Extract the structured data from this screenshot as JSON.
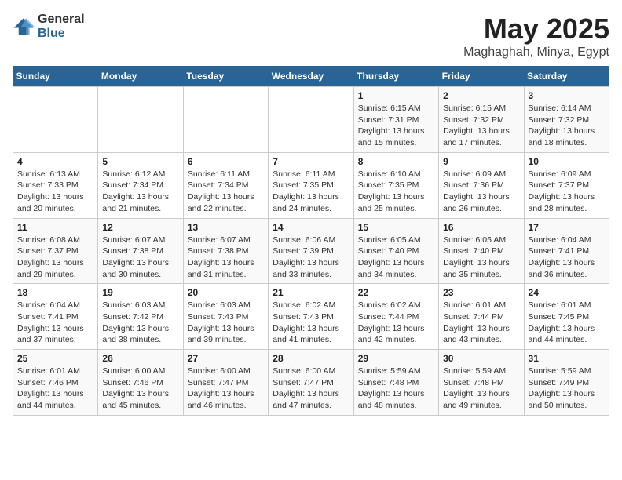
{
  "logo": {
    "general": "General",
    "blue": "Blue"
  },
  "calendar": {
    "title": "May 2025",
    "subtitle": "Maghaghah, Minya, Egypt"
  },
  "weekdays": [
    "Sunday",
    "Monday",
    "Tuesday",
    "Wednesday",
    "Thursday",
    "Friday",
    "Saturday"
  ],
  "weeks": [
    [
      {
        "day": "",
        "info": ""
      },
      {
        "day": "",
        "info": ""
      },
      {
        "day": "",
        "info": ""
      },
      {
        "day": "",
        "info": ""
      },
      {
        "day": "1",
        "info": "Sunrise: 6:15 AM\nSunset: 7:31 PM\nDaylight: 13 hours and 15 minutes."
      },
      {
        "day": "2",
        "info": "Sunrise: 6:15 AM\nSunset: 7:32 PM\nDaylight: 13 hours and 17 minutes."
      },
      {
        "day": "3",
        "info": "Sunrise: 6:14 AM\nSunset: 7:32 PM\nDaylight: 13 hours and 18 minutes."
      }
    ],
    [
      {
        "day": "4",
        "info": "Sunrise: 6:13 AM\nSunset: 7:33 PM\nDaylight: 13 hours and 20 minutes."
      },
      {
        "day": "5",
        "info": "Sunrise: 6:12 AM\nSunset: 7:34 PM\nDaylight: 13 hours and 21 minutes."
      },
      {
        "day": "6",
        "info": "Sunrise: 6:11 AM\nSunset: 7:34 PM\nDaylight: 13 hours and 22 minutes."
      },
      {
        "day": "7",
        "info": "Sunrise: 6:11 AM\nSunset: 7:35 PM\nDaylight: 13 hours and 24 minutes."
      },
      {
        "day": "8",
        "info": "Sunrise: 6:10 AM\nSunset: 7:35 PM\nDaylight: 13 hours and 25 minutes."
      },
      {
        "day": "9",
        "info": "Sunrise: 6:09 AM\nSunset: 7:36 PM\nDaylight: 13 hours and 26 minutes."
      },
      {
        "day": "10",
        "info": "Sunrise: 6:09 AM\nSunset: 7:37 PM\nDaylight: 13 hours and 28 minutes."
      }
    ],
    [
      {
        "day": "11",
        "info": "Sunrise: 6:08 AM\nSunset: 7:37 PM\nDaylight: 13 hours and 29 minutes."
      },
      {
        "day": "12",
        "info": "Sunrise: 6:07 AM\nSunset: 7:38 PM\nDaylight: 13 hours and 30 minutes."
      },
      {
        "day": "13",
        "info": "Sunrise: 6:07 AM\nSunset: 7:38 PM\nDaylight: 13 hours and 31 minutes."
      },
      {
        "day": "14",
        "info": "Sunrise: 6:06 AM\nSunset: 7:39 PM\nDaylight: 13 hours and 33 minutes."
      },
      {
        "day": "15",
        "info": "Sunrise: 6:05 AM\nSunset: 7:40 PM\nDaylight: 13 hours and 34 minutes."
      },
      {
        "day": "16",
        "info": "Sunrise: 6:05 AM\nSunset: 7:40 PM\nDaylight: 13 hours and 35 minutes."
      },
      {
        "day": "17",
        "info": "Sunrise: 6:04 AM\nSunset: 7:41 PM\nDaylight: 13 hours and 36 minutes."
      }
    ],
    [
      {
        "day": "18",
        "info": "Sunrise: 6:04 AM\nSunset: 7:41 PM\nDaylight: 13 hours and 37 minutes."
      },
      {
        "day": "19",
        "info": "Sunrise: 6:03 AM\nSunset: 7:42 PM\nDaylight: 13 hours and 38 minutes."
      },
      {
        "day": "20",
        "info": "Sunrise: 6:03 AM\nSunset: 7:43 PM\nDaylight: 13 hours and 39 minutes."
      },
      {
        "day": "21",
        "info": "Sunrise: 6:02 AM\nSunset: 7:43 PM\nDaylight: 13 hours and 41 minutes."
      },
      {
        "day": "22",
        "info": "Sunrise: 6:02 AM\nSunset: 7:44 PM\nDaylight: 13 hours and 42 minutes."
      },
      {
        "day": "23",
        "info": "Sunrise: 6:01 AM\nSunset: 7:44 PM\nDaylight: 13 hours and 43 minutes."
      },
      {
        "day": "24",
        "info": "Sunrise: 6:01 AM\nSunset: 7:45 PM\nDaylight: 13 hours and 44 minutes."
      }
    ],
    [
      {
        "day": "25",
        "info": "Sunrise: 6:01 AM\nSunset: 7:46 PM\nDaylight: 13 hours and 44 minutes."
      },
      {
        "day": "26",
        "info": "Sunrise: 6:00 AM\nSunset: 7:46 PM\nDaylight: 13 hours and 45 minutes."
      },
      {
        "day": "27",
        "info": "Sunrise: 6:00 AM\nSunset: 7:47 PM\nDaylight: 13 hours and 46 minutes."
      },
      {
        "day": "28",
        "info": "Sunrise: 6:00 AM\nSunset: 7:47 PM\nDaylight: 13 hours and 47 minutes."
      },
      {
        "day": "29",
        "info": "Sunrise: 5:59 AM\nSunset: 7:48 PM\nDaylight: 13 hours and 48 minutes."
      },
      {
        "day": "30",
        "info": "Sunrise: 5:59 AM\nSunset: 7:48 PM\nDaylight: 13 hours and 49 minutes."
      },
      {
        "day": "31",
        "info": "Sunrise: 5:59 AM\nSunset: 7:49 PM\nDaylight: 13 hours and 50 minutes."
      }
    ]
  ]
}
